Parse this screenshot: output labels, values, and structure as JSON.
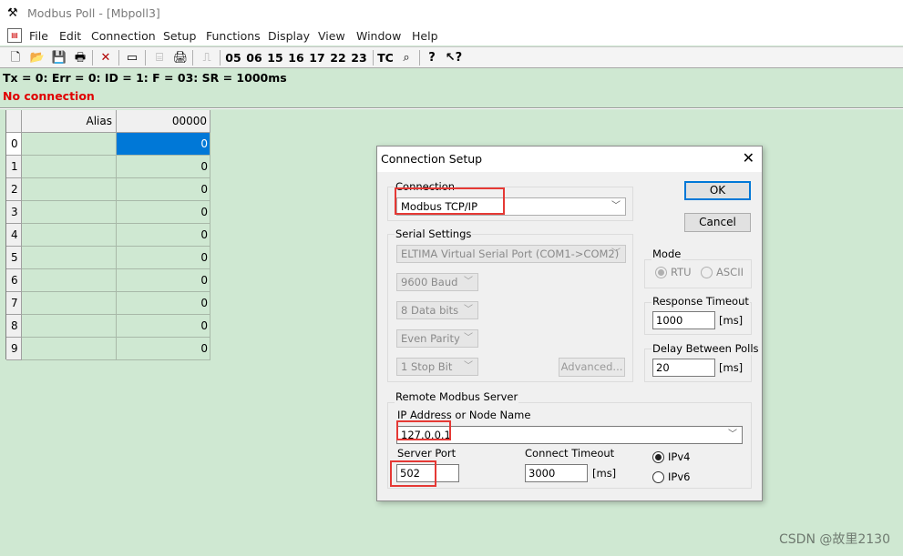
{
  "window": {
    "title": "Modbus Poll - [Mbpoll3]",
    "app_icon": "modbus-app-icon"
  },
  "menu": [
    "File",
    "Edit",
    "Connection",
    "Setup",
    "Functions",
    "Display",
    "View",
    "Window",
    "Help"
  ],
  "toolbar": {
    "function_codes": [
      "05",
      "06",
      "15",
      "16",
      "17",
      "22",
      "23"
    ],
    "tc_label": "TC",
    "icons": [
      "new-icon",
      "open-icon",
      "save-icon",
      "print-icon",
      "delete-icon",
      "window-icon",
      "connect-icon",
      "printer-queue-icon",
      "pulse-icon",
      "comm-traffic-icon",
      "help-icon",
      "context-help-icon"
    ]
  },
  "status": {
    "line1": "Tx = 0: Err = 0: ID = 1: F = 03: SR = 1000ms",
    "line2": "No connection",
    "line2_color": "#e00000"
  },
  "grid": {
    "col_alias": "Alias",
    "col_value": "00000",
    "rows": [
      {
        "idx": "0",
        "value": "0"
      },
      {
        "idx": "1",
        "value": "0"
      },
      {
        "idx": "2",
        "value": "0"
      },
      {
        "idx": "3",
        "value": "0"
      },
      {
        "idx": "4",
        "value": "0"
      },
      {
        "idx": "5",
        "value": "0"
      },
      {
        "idx": "6",
        "value": "0"
      },
      {
        "idx": "7",
        "value": "0"
      },
      {
        "idx": "8",
        "value": "0"
      },
      {
        "idx": "9",
        "value": "0"
      }
    ],
    "selected_color": "#0078d7"
  },
  "dialog": {
    "title": "Connection Setup",
    "connection_group": "Connection",
    "connection_value": "Modbus TCP/IP",
    "serial_group": "Serial Settings",
    "serial_port": "ELTIMA Virtual Serial Port (COM1->COM2)",
    "baud": "9600 Baud",
    "data_bits": "8 Data bits",
    "parity": "Even Parity",
    "stop_bits": "1 Stop Bit",
    "advanced": "Advanced...",
    "ok": "OK",
    "cancel": "Cancel",
    "mode_group": "Mode",
    "mode_rtu": "RTU",
    "mode_ascii": "ASCII",
    "response_group": "Response Timeout",
    "response_value": "1000",
    "response_unit": "[ms]",
    "delay_group": "Delay Between Polls",
    "delay_value": "20",
    "delay_unit": "[ms]",
    "remote_group": "Remote Modbus Server",
    "ip_label": "IP Address or Node Name",
    "ip_value": "127.0.0.1",
    "port_label": "Server Port",
    "port_value": "502",
    "connect_timeout_label": "Connect Timeout",
    "connect_timeout_value": "3000",
    "connect_timeout_unit": "[ms]",
    "ipv4": "IPv4",
    "ipv6": "IPv6",
    "highlight_color": "#e53935"
  },
  "watermark": "CSDN @故里2130"
}
